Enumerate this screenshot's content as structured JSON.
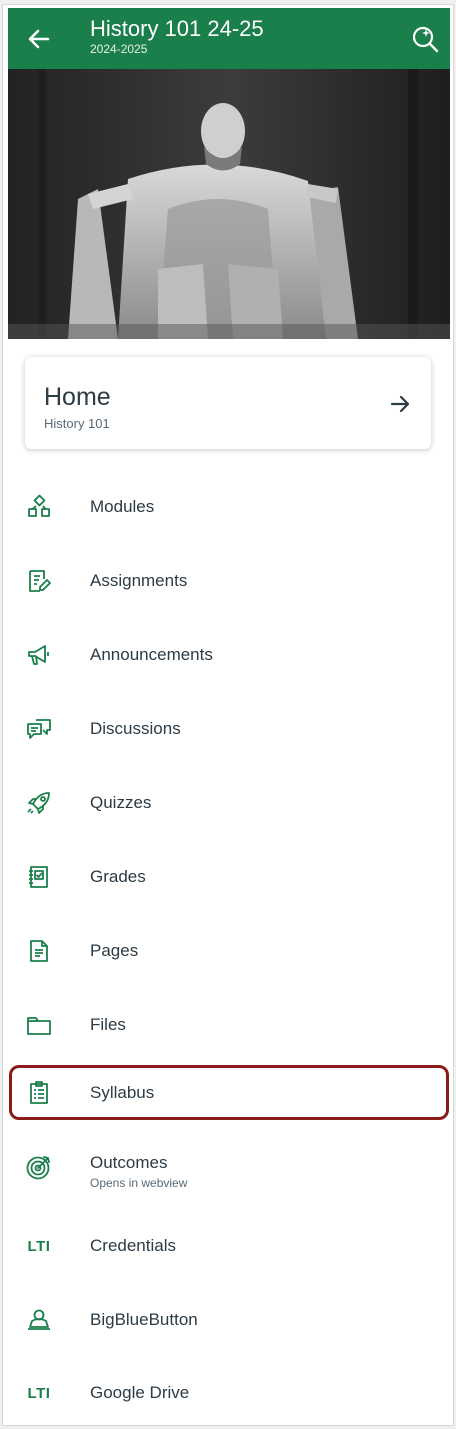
{
  "colors": {
    "header_bg": "#1a7f4b",
    "accent": "#1a7f4b",
    "text_primary": "#2d3b45",
    "text_secondary": "#5b6a75",
    "highlight_border": "#8b1a1a"
  },
  "header": {
    "title": "History 101 24-25",
    "subtitle": "2024-2025",
    "back_icon": "arrow-left-icon",
    "search_icon": "search-sparkle-icon"
  },
  "hero": {
    "image_description": "Lincoln Memorial statue, black and white"
  },
  "home_card": {
    "title": "Home",
    "subtitle": "History 101",
    "arrow_icon": "arrow-right-icon"
  },
  "menu": [
    {
      "label": "Modules",
      "icon": "modules-icon"
    },
    {
      "label": "Assignments",
      "icon": "assignments-icon"
    },
    {
      "label": "Announcements",
      "icon": "megaphone-icon"
    },
    {
      "label": "Discussions",
      "icon": "discussions-icon"
    },
    {
      "label": "Quizzes",
      "icon": "rocket-icon"
    },
    {
      "label": "Grades",
      "icon": "gradebook-icon"
    },
    {
      "label": "Pages",
      "icon": "document-icon"
    },
    {
      "label": "Files",
      "icon": "folder-icon"
    },
    {
      "label": "Syllabus",
      "icon": "syllabus-icon"
    },
    {
      "label": "Outcomes",
      "sublabel": "Opens in webview",
      "icon": "target-icon"
    },
    {
      "label": "Credentials",
      "icon": "lti-icon",
      "icon_text": "LTI"
    },
    {
      "label": "BigBlueButton",
      "icon": "presenter-icon"
    },
    {
      "label": "Google Drive",
      "icon": "lti-icon",
      "icon_text": "LTI"
    }
  ]
}
